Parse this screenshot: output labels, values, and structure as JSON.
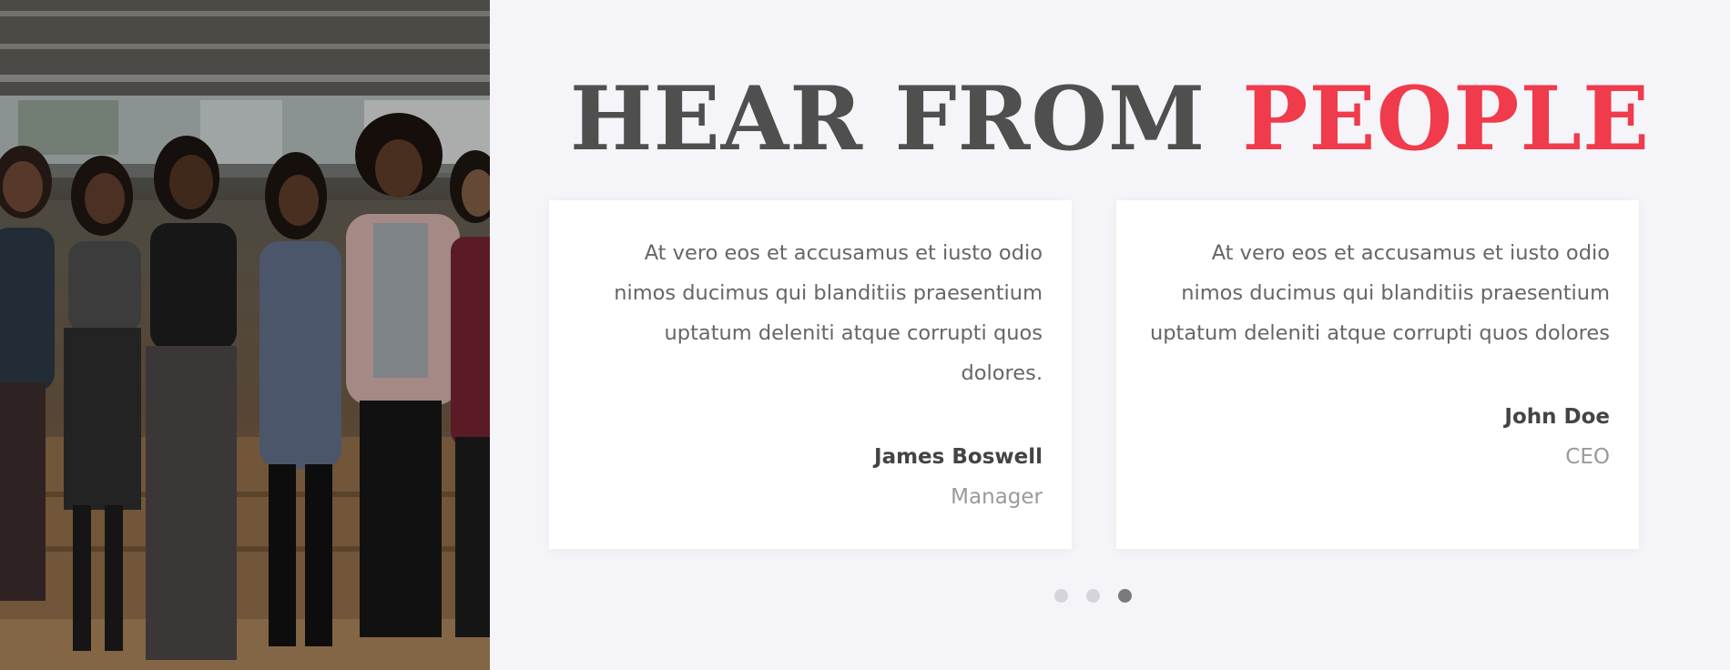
{
  "section": {
    "title_word1": "HEAR FROM",
    "title_word2": "PEOPLE"
  },
  "testimonials": [
    {
      "quote": "At vero eos et accusamus et iusto odio nimos ducimus qui blanditiis praesentium uptatum deleniti atque corrupti quos dolores.",
      "name": "James Boswell",
      "role": "Manager"
    },
    {
      "quote": "At vero eos et accusamus et iusto odio nimos ducimus qui blanditiis praesentium uptatum deleniti atque corrupti quos dolores",
      "name": "John Doe",
      "role": "CEO"
    }
  ],
  "pagination": {
    "count": 3,
    "active_index": 2
  },
  "colors": {
    "accent": "#ef3b4b",
    "heading_dark": "#4f4f4f",
    "background": "#f4f4f9"
  },
  "image": {
    "subject": "group-photo-of-smiling-women-in-office"
  }
}
